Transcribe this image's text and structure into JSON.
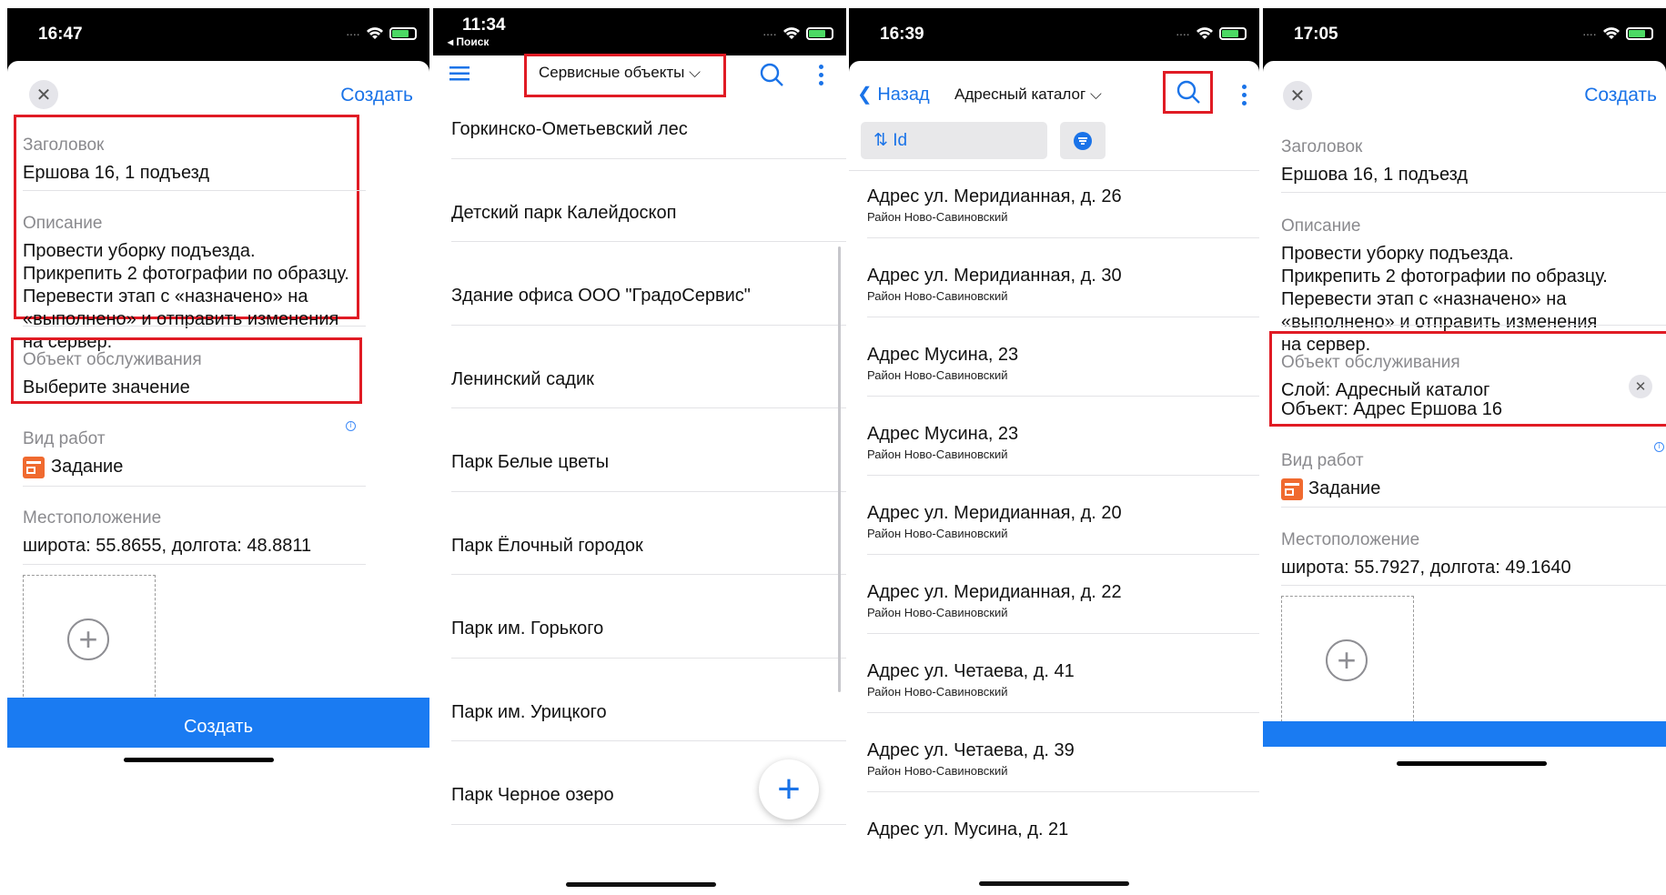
{
  "screen1": {
    "time": "16:47",
    "close_icon": "close-icon",
    "create_link": "Создать",
    "title_label": "Заголовок",
    "title_value": "Ершова 16, 1 подъезд",
    "desc_label": "Описание",
    "desc_value": "Провести уборку подъезда. Прикрепить 2 фотографии по образцу. Перевести этап с «назначено» на «выполнено» и отправить изменения на сервер.",
    "object_label": "Объект обслуживания",
    "object_value": "Выберите значение",
    "worktype_label": "Вид работ",
    "worktype_value": "Задание",
    "location_label": "Местоположение",
    "location_value": "широта: 55.8655, долгота: 48.8811",
    "create_button": "Создать"
  },
  "screen2": {
    "time": "11:34",
    "back_app": "◂ Поиск",
    "menu_icon": "hamburger-menu-icon",
    "title": "Сервисные объекты",
    "items": [
      "Горкинско-Ометьевский лес",
      "Детский парк Калейдоскоп",
      "Здание офиса ООО \"ГрадоСервис\"",
      "Ленинский садик",
      "Парк Белые цветы",
      "Парк Ёлочный городок",
      "Парк им. Горького",
      "Парк им. Урицкого",
      "Парк Черное озеро"
    ],
    "fab": "+"
  },
  "screen3": {
    "time": "16:39",
    "back_label": "Назад",
    "title": "Адресный каталог",
    "sort_label": "⇅ Id",
    "addresses": [
      {
        "a": "Адрес  ул. Меридианная, д. 26",
        "d": "Район  Ново-Савиновский"
      },
      {
        "a": "Адрес  ул. Меридианная, д. 30",
        "d": "Район  Ново-Савиновский"
      },
      {
        "a": "Адрес  Мусина, 23",
        "d": "Район  Ново-Савиновский"
      },
      {
        "a": "Адрес  Мусина, 23",
        "d": "Район  Ново-Савиновский"
      },
      {
        "a": "Адрес  ул. Меридианная, д. 20",
        "d": "Район  Ново-Савиновский"
      },
      {
        "a": "Адрес  ул. Меридианная, д. 22",
        "d": "Район  Ново-Савиновский"
      },
      {
        "a": "Адрес  ул. Четаева, д. 41",
        "d": "Район  Ново-Савиновский"
      },
      {
        "a": "Адрес  ул. Четаева, д. 39",
        "d": "Район  Ново-Савиновский"
      },
      {
        "a": "Адрес  ул. Мусина, д. 21",
        "d": ""
      }
    ]
  },
  "screen4": {
    "time": "17:05",
    "create_link": "Создать",
    "title_label": "Заголовок",
    "title_value": "Ершова 16, 1 подъезд",
    "desc_label": "Описание",
    "desc_value": "Провести уборку подъезда. Прикрепить 2 фотографии по образцу. Перевести этап с «назначено» на «выполнено» и отправить изменения на сервер.",
    "object_label": "Объект обслуживания",
    "object_line1": "Слой: Адресный каталог",
    "object_line2": "Объект: Адрес  Ершова 16",
    "worktype_label": "Вид работ",
    "worktype_value": "Задание",
    "location_label": "Местоположение",
    "location_value": "широта: 55.7927, долгота: 49.1640"
  },
  "colors": {
    "accent": "#1a73e8",
    "highlight": "#e01b24",
    "button": "#1a7bf2"
  }
}
